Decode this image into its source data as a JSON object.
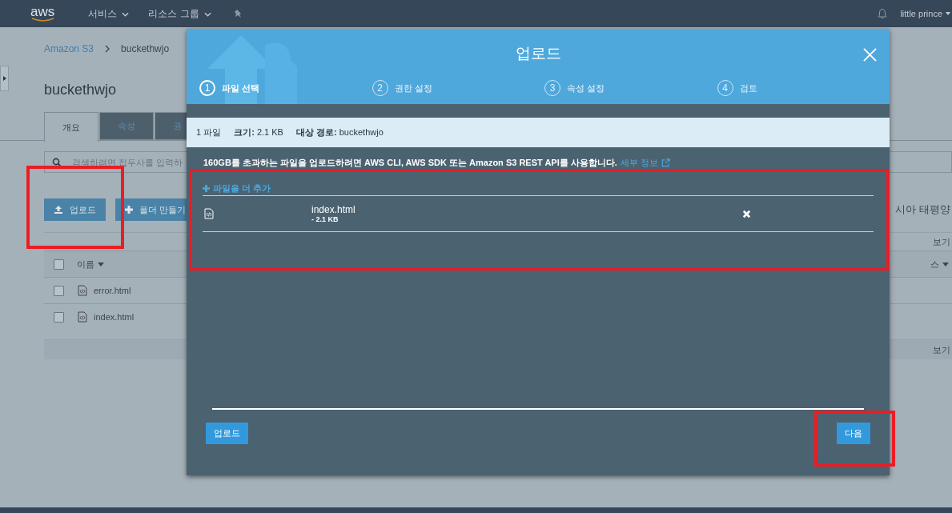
{
  "nav": {
    "logo": "aws",
    "services": "서비스",
    "resource_groups": "리소스 그룹",
    "user": "little prince"
  },
  "breadcrumb": [
    "Amazon S3",
    "buckethwjo"
  ],
  "bucket_title": "buckethwjo",
  "tabs": [
    {
      "label": "개요",
      "selected": true
    },
    {
      "label": "속성",
      "selected": false
    },
    {
      "label": "권",
      "selected": false
    }
  ],
  "search": {
    "placeholder": "검색하려면 접두사를 입력하"
  },
  "actions": {
    "upload": "업로드",
    "create_folder": "폴더 만들기"
  },
  "region": "시아 태평양",
  "view_links": [
    "보기",
    "보기"
  ],
  "table": {
    "select_all_checked": false,
    "columns": [
      "이름",
      "스"
    ],
    "rows": [
      {
        "name": "error.html",
        "checked": false
      },
      {
        "name": "index.html",
        "checked": false
      }
    ]
  },
  "dialog": {
    "title": "업로드",
    "steps": [
      {
        "number": "1",
        "label": "파일 선택",
        "selected": true
      },
      {
        "number": "2",
        "label": "권한 설정",
        "selected": false
      },
      {
        "number": "3",
        "label": "속성 설정",
        "selected": false
      },
      {
        "number": "4",
        "label": "검토",
        "selected": false
      }
    ],
    "summary": [
      "1 파일",
      "**크기:** 2.1 KB",
      "**대상 경로:** buckethwjo"
    ],
    "notice": "160GB를 초과하는 파일을 업로드하려면 AWS CLI, AWS SDK 또는 Amazon S3 REST API를 사용합니다.",
    "notice_link": "세부 정보",
    "add_more": "파일을 더 추가",
    "files": [
      {
        "name": "index.html",
        "size": "- 2.1 KB"
      }
    ],
    "upload_button": "업로드",
    "next_button": "다음"
  },
  "highlights": {
    "upload_button": true,
    "file_list": true,
    "next_button": true
  }
}
